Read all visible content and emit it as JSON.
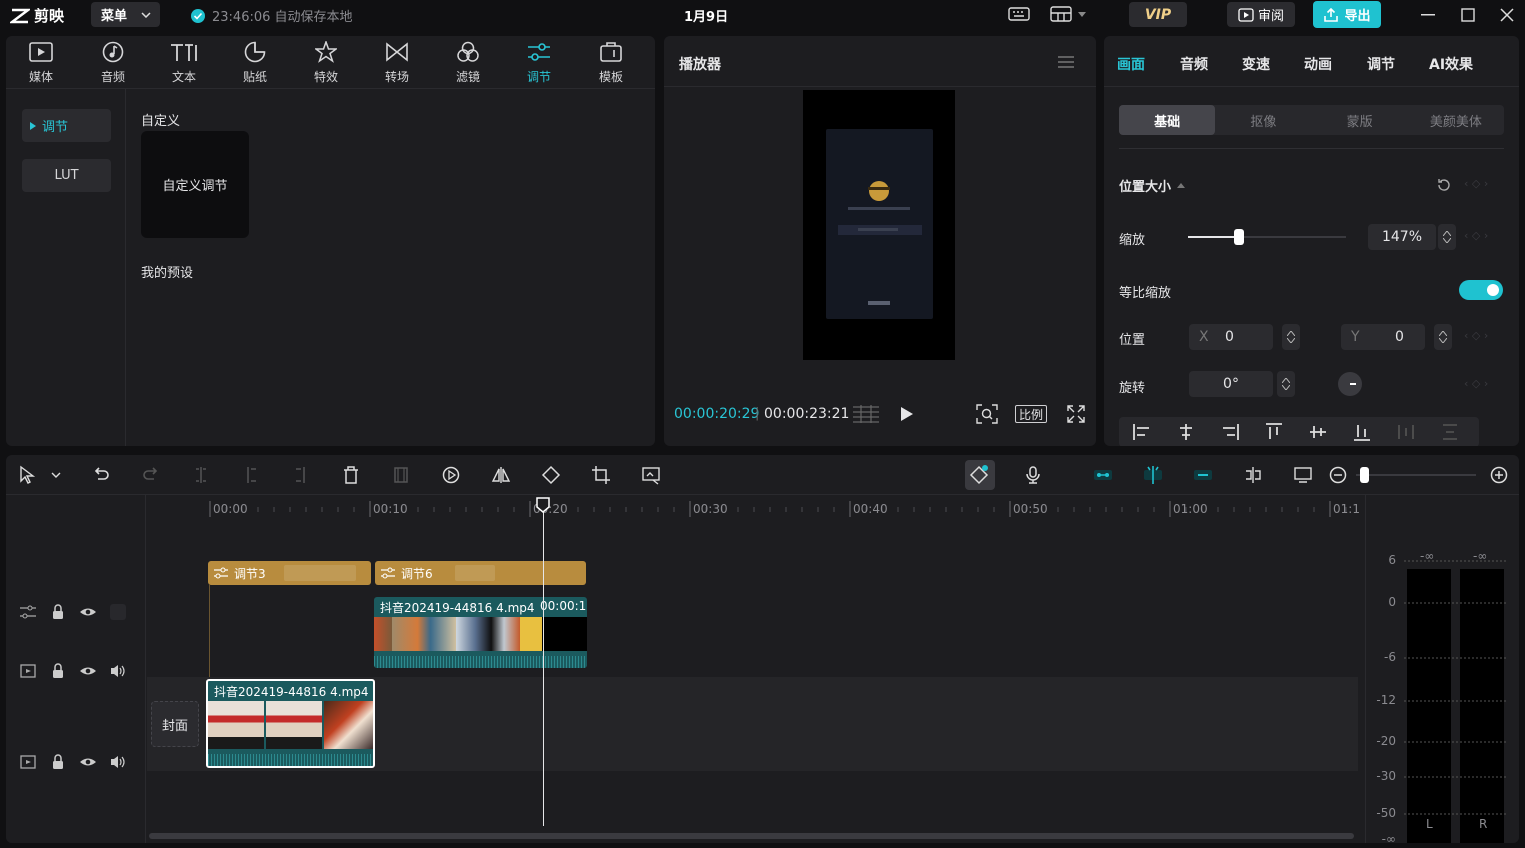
{
  "app": {
    "logo_text": "剪映",
    "menu_label": "菜单",
    "autosave_text": "23:46:06 自动保存本地",
    "date": "1月9日",
    "vip_label": "VIP",
    "review_label": "审阅",
    "export_label": "导出"
  },
  "media": {
    "tabs": [
      {
        "label": "媒体",
        "icon": "media-icon"
      },
      {
        "label": "音频",
        "icon": "audio-icon"
      },
      {
        "label": "文本",
        "icon": "text-icon"
      },
      {
        "label": "贴纸",
        "icon": "sticker-icon"
      },
      {
        "label": "特效",
        "icon": "effects-icon"
      },
      {
        "label": "转场",
        "icon": "transition-icon"
      },
      {
        "label": "滤镜",
        "icon": "filter-icon"
      },
      {
        "label": "调节",
        "icon": "adjust-icon"
      },
      {
        "label": "模板",
        "icon": "template-icon"
      }
    ],
    "active_tab": "调节",
    "sidebar": [
      "调节",
      "LUT"
    ],
    "section_custom": "自定义",
    "custom_card_label": "自定义调节",
    "section_presets": "我的预设"
  },
  "player": {
    "title": "播放器",
    "time_current": "00:00:20:29",
    "time_total": "00:00:23:21",
    "ratio_label": "比例"
  },
  "props": {
    "tabs": [
      "画面",
      "音频",
      "变速",
      "动画",
      "调节",
      "AI效果"
    ],
    "active_tab": "画面",
    "subtabs": [
      "基础",
      "抠像",
      "蒙版",
      "美颜美体"
    ],
    "active_subtab": "基础",
    "section_title": "位置大小",
    "scale_label": "缩放",
    "scale_value": "147%",
    "scale_fraction": 0.32,
    "uniform_label": "等比缩放",
    "uniform_on": true,
    "position_label": "位置",
    "x_label": "X",
    "x_value": "0",
    "y_label": "Y",
    "y_value": "0",
    "rotate_label": "旋转",
    "rotate_value": "0°"
  },
  "timeline": {
    "ruler_labels": [
      "00:00",
      "00:10",
      "00:20",
      "00:30",
      "00:40",
      "00:50",
      "01:00",
      "01:1"
    ],
    "adjust_clips": [
      "调节3",
      "调节6"
    ],
    "overlay_clip_name": "抖音202419-44816 4.mp4",
    "overlay_clip_time": "00:00:1",
    "main_clip_name": "抖音202419-44816 4.mp4",
    "cover_label": "封面",
    "vu_scale": [
      "6",
      "0",
      "-6",
      "-12",
      "-20",
      "-30",
      "-50",
      "-∞"
    ],
    "vu_top": [
      "-∞",
      "-∞"
    ],
    "vu_channels": [
      "L",
      "R"
    ]
  },
  "colors": {
    "accent": "#1fc2d0",
    "adjust_clip": "#b88c3e",
    "video_clip": "#1b5a5e",
    "panel_bg": "#1d1d20"
  }
}
